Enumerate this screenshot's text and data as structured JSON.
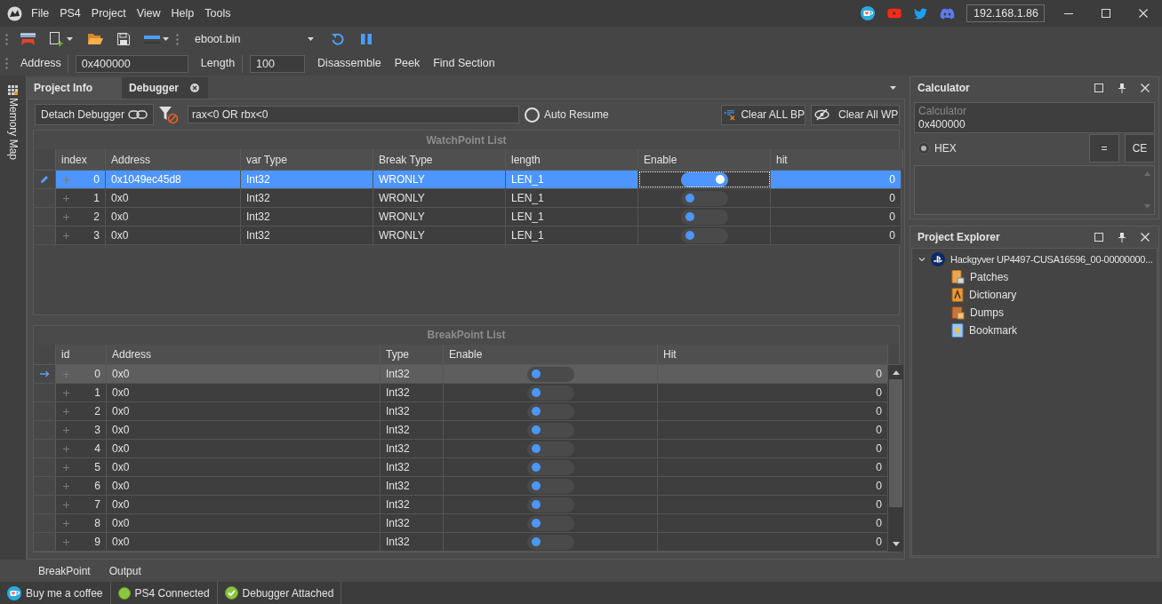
{
  "title_bar": {
    "menu": [
      "File",
      "PS4",
      "Project",
      "View",
      "Help",
      "Tools"
    ],
    "ip_address": "192.168.1.86"
  },
  "toolbar": {
    "file_dropdown": "eboot.bin"
  },
  "address_bar": {
    "address_label": "Address",
    "address": "0x400000",
    "length_label": "Length",
    "length": "100",
    "actions": [
      "Disassemble",
      "Peek",
      "Find Section"
    ]
  },
  "side_panel": {
    "label": "Memory Map"
  },
  "tabs": [
    {
      "label": "Project Info",
      "selected": false
    },
    {
      "label": "Debugger",
      "selected": true
    }
  ],
  "debugger": {
    "detach_button": "Detach Debugger",
    "condition_field": {
      "value": "rax<0 OR rbx<0"
    },
    "auto_resume": {
      "label": "Auto Resume",
      "checked": false
    },
    "clear_bp_button": "Clear ALL BP",
    "clear_wp_button": "Clear All WP",
    "watchpoints": {
      "title": "WatchPoint List",
      "focused": true,
      "columns": [
        "index",
        "Address",
        "var Type",
        "Break Type",
        "length",
        "Enable",
        "hit"
      ],
      "rows": [
        {
          "index": "0",
          "address": "0x1049ec45d8",
          "var_type": "Int32",
          "break_type": "WRONLY",
          "length": "LEN_1",
          "enabled": true,
          "hit": "0",
          "selected": true
        },
        {
          "index": "1",
          "address": "0x0",
          "var_type": "Int32",
          "break_type": "WRONLY",
          "length": "LEN_1",
          "enabled": false,
          "hit": "0",
          "selected": false
        },
        {
          "index": "2",
          "address": "0x0",
          "var_type": "Int32",
          "break_type": "WRONLY",
          "length": "LEN_1",
          "enabled": false,
          "hit": "0",
          "selected": false
        },
        {
          "index": "3",
          "address": "0x0",
          "var_type": "Int32",
          "break_type": "WRONLY",
          "length": "LEN_1",
          "enabled": false,
          "hit": "0",
          "selected": false
        }
      ]
    },
    "breakpoints": {
      "title": "BreakPoint List",
      "focused": false,
      "columns": [
        "id",
        "Address",
        "Type",
        "Enable",
        "Hit"
      ],
      "rows": [
        {
          "id": "0",
          "address": "0x0",
          "type": "Int32",
          "enabled": false,
          "hit": "0",
          "selected": true
        },
        {
          "id": "1",
          "address": "0x0",
          "type": "Int32",
          "enabled": false,
          "hit": "0",
          "selected": false
        },
        {
          "id": "2",
          "address": "0x0",
          "type": "Int32",
          "enabled": false,
          "hit": "0",
          "selected": false
        },
        {
          "id": "3",
          "address": "0x0",
          "type": "Int32",
          "enabled": false,
          "hit": "0",
          "selected": false
        },
        {
          "id": "4",
          "address": "0x0",
          "type": "Int32",
          "enabled": false,
          "hit": "0",
          "selected": false
        },
        {
          "id": "5",
          "address": "0x0",
          "type": "Int32",
          "enabled": false,
          "hit": "0",
          "selected": false
        },
        {
          "id": "6",
          "address": "0x0",
          "type": "Int32",
          "enabled": false,
          "hit": "0",
          "selected": false
        },
        {
          "id": "7",
          "address": "0x0",
          "type": "Int32",
          "enabled": false,
          "hit": "0",
          "selected": false
        },
        {
          "id": "8",
          "address": "0x0",
          "type": "Int32",
          "enabled": false,
          "hit": "0",
          "selected": false
        },
        {
          "id": "9",
          "address": "0x0",
          "type": "Int32",
          "enabled": false,
          "hit": "0",
          "selected": false
        }
      ]
    }
  },
  "calculator": {
    "title": "Calculator",
    "input": {
      "label": "Calculator",
      "value": "0x400000"
    },
    "hex": {
      "label": "HEX",
      "checked": true
    },
    "buttons": [
      "=",
      "CE"
    ]
  },
  "project_explorer": {
    "title": "Project Explorer",
    "tree": [
      {
        "label": "Hackgyver UP4497-CUSA16596_00-00000000...",
        "kind": "project",
        "expanded": true,
        "children": [
          {
            "label": "Patches",
            "kind": "patches"
          },
          {
            "label": "Dictionary",
            "kind": "dictionary"
          },
          {
            "label": "Dumps",
            "kind": "dumps"
          },
          {
            "label": "Bookmark",
            "kind": "bookmark"
          }
        ]
      }
    ]
  },
  "bottom_tabs": [
    "BreakPoint",
    "Output"
  ],
  "status_bar": [
    {
      "kind": "coffee",
      "label": "Buy me a coffee"
    },
    {
      "kind": "connected",
      "label": "PS4 Connected"
    },
    {
      "kind": "attached",
      "label": "Debugger Attached"
    }
  ]
}
